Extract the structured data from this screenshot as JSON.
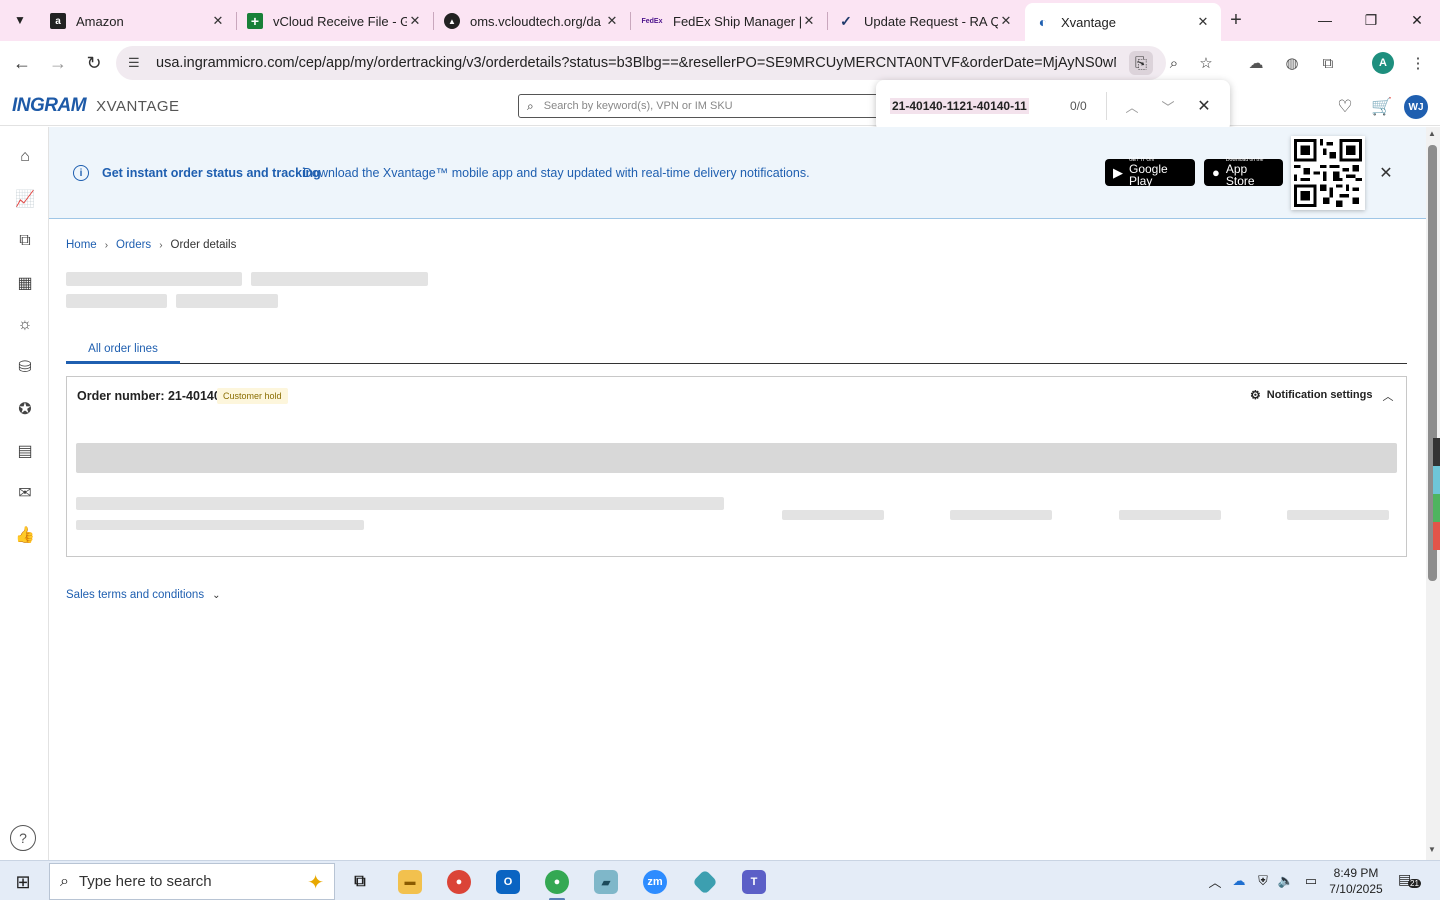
{
  "browser": {
    "tabs": [
      {
        "title": "Amazon",
        "favicon": "amazon-icon",
        "fav_glyph": "a",
        "fav_color": "#222222"
      },
      {
        "title": "vCloud Receive File - Go",
        "favicon": "google-sheets-icon",
        "fav_glyph": "+",
        "fav_color": "#188038"
      },
      {
        "title": "oms.vcloudtech.org/da",
        "favicon": "oms-icon",
        "fav_glyph": "▲",
        "fav_color": "#222222"
      },
      {
        "title": "FedEx Ship Manager | C",
        "favicon": "fedex-icon",
        "fav_glyph": "FedEx",
        "fav_color": "#4d148c"
      },
      {
        "title": "Update Request - RA Q",
        "favicon": "update-request-icon",
        "fav_glyph": "✓",
        "fav_color": "#1f3a6b"
      },
      {
        "title": "Xvantage",
        "favicon": "xvantage-icon",
        "fav_glyph": "◐",
        "fav_color": "#1f5fb0",
        "active": true
      }
    ],
    "url": "usa.ingrammicro.com/cep/app/my/ordertracking/v3/orderdetails?status=b3Blbg==&resellerPO=SE9MRCUyMERCNTA0NTVF&orderDate=MjAyNS0wNi0y...",
    "profile_initial": "A"
  },
  "findbar": {
    "query": "21-40140-1121-40140-11",
    "count": "0/0"
  },
  "site": {
    "logo_main": "INGRAM",
    "logo_sub": "XVANTAGE",
    "search_placeholder": "Search by keyword(s), VPN or IM SKU",
    "avatar_initials": "WJ"
  },
  "banner": {
    "title": "Get instant order status and tracking",
    "text": "Download the Xvantage™ mobile app and stay updated with real-time delivery notifications.",
    "google_small": "GET IT ON",
    "google_big": "Google Play",
    "apple_small": "Download on the",
    "apple_big": "App Store"
  },
  "breadcrumb": {
    "home": "Home",
    "orders": "Orders",
    "current": "Order details"
  },
  "tabs": {
    "all_order_lines": "All order lines"
  },
  "order": {
    "number_label": "Order number: 21-40140",
    "status": "Customer hold",
    "notification_settings": "Notification settings"
  },
  "sales_terms": "Sales terms and conditions",
  "taskbar": {
    "search_placeholder": "Type here to search",
    "time": "8:49 PM",
    "date": "7/10/2025",
    "notification_count": "21"
  },
  "colors": {
    "brand_blue": "#1f5fb0",
    "tabstrip": "#fbe4f3",
    "hold_badge_bg": "#fdf6dc"
  }
}
